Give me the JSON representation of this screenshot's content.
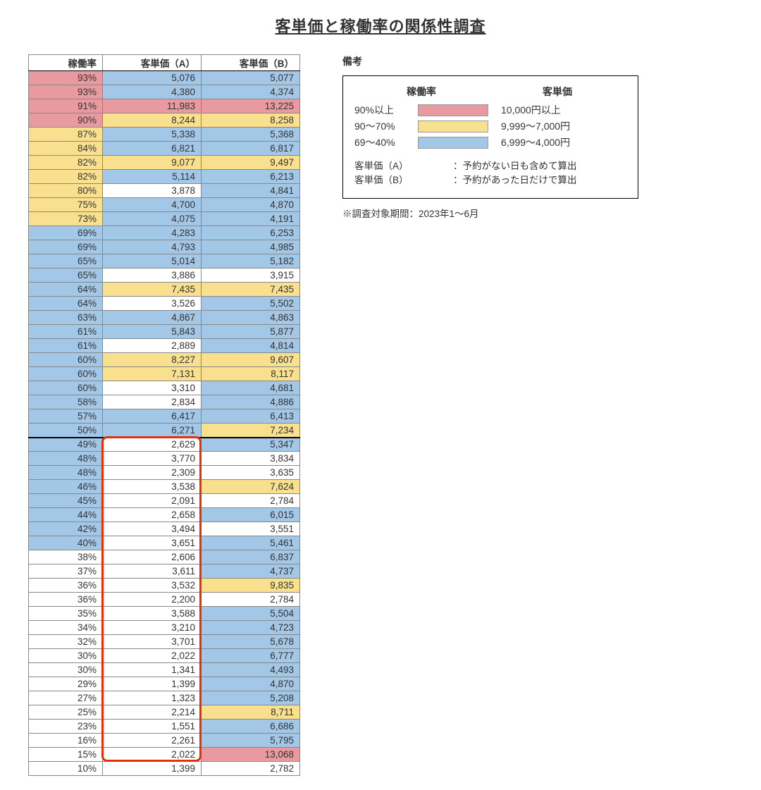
{
  "title": "客単価と稼働率の関係性調査",
  "columns": {
    "rate": "稼働率",
    "a": "客単価（A）",
    "b": "客単価（B）"
  },
  "legend": {
    "title": "備考",
    "head_rate": "稼働率",
    "head_price": "客単価",
    "rows": [
      {
        "rate": "90%以上",
        "price": "10,000円以上",
        "color": "c-pink"
      },
      {
        "rate": "90～70%",
        "price": "9,999～7,000円",
        "color": "c-yellow"
      },
      {
        "rate": "69～40%",
        "price": "6,999～4,000円",
        "color": "c-blue"
      }
    ],
    "notes": [
      {
        "k": "客単価（A）",
        "v": "：予約がない日も含めて算出"
      },
      {
        "k": "客単価（B）",
        "v": "：予約があった日だけで算出"
      }
    ],
    "period": "※調査対象期間：2023年1～6月"
  },
  "highlight": {
    "col": "a",
    "from_row": 26,
    "to_row": 48
  },
  "rows": [
    {
      "rate": "93%",
      "rc": "c-pink",
      "a": "5,076",
      "ac": "c-blue",
      "b": "5,077",
      "bc": "c-blue"
    },
    {
      "rate": "93%",
      "rc": "c-pink",
      "a": "4,380",
      "ac": "c-blue",
      "b": "4,374",
      "bc": "c-blue"
    },
    {
      "rate": "91%",
      "rc": "c-pink",
      "a": "11,983",
      "ac": "c-pink",
      "b": "13,225",
      "bc": "c-pink"
    },
    {
      "rate": "90%",
      "rc": "c-pink",
      "a": "8,244",
      "ac": "c-yellow",
      "b": "8,258",
      "bc": "c-yellow"
    },
    {
      "rate": "87%",
      "rc": "c-yellow",
      "a": "5,338",
      "ac": "c-blue",
      "b": "5,368",
      "bc": "c-blue"
    },
    {
      "rate": "84%",
      "rc": "c-yellow",
      "a": "6,821",
      "ac": "c-blue",
      "b": "6,817",
      "bc": "c-blue"
    },
    {
      "rate": "82%",
      "rc": "c-yellow",
      "a": "9,077",
      "ac": "c-yellow",
      "b": "9,497",
      "bc": "c-yellow"
    },
    {
      "rate": "82%",
      "rc": "c-yellow",
      "a": "5,114",
      "ac": "c-blue",
      "b": "6,213",
      "bc": "c-blue"
    },
    {
      "rate": "80%",
      "rc": "c-yellow",
      "a": "3,878",
      "ac": "c-white",
      "b": "4,841",
      "bc": "c-blue"
    },
    {
      "rate": "75%",
      "rc": "c-yellow",
      "a": "4,700",
      "ac": "c-blue",
      "b": "4,870",
      "bc": "c-blue"
    },
    {
      "rate": "73%",
      "rc": "c-yellow",
      "a": "4,075",
      "ac": "c-blue",
      "b": "4,191",
      "bc": "c-blue"
    },
    {
      "rate": "69%",
      "rc": "c-blue",
      "a": "4,283",
      "ac": "c-blue",
      "b": "6,253",
      "bc": "c-blue"
    },
    {
      "rate": "69%",
      "rc": "c-blue",
      "a": "4,793",
      "ac": "c-blue",
      "b": "4,985",
      "bc": "c-blue"
    },
    {
      "rate": "65%",
      "rc": "c-blue",
      "a": "5,014",
      "ac": "c-blue",
      "b": "5,182",
      "bc": "c-blue"
    },
    {
      "rate": "65%",
      "rc": "c-blue",
      "a": "3,886",
      "ac": "c-white",
      "b": "3,915",
      "bc": "c-white"
    },
    {
      "rate": "64%",
      "rc": "c-blue",
      "a": "7,435",
      "ac": "c-yellow",
      "b": "7,435",
      "bc": "c-yellow"
    },
    {
      "rate": "64%",
      "rc": "c-blue",
      "a": "3,526",
      "ac": "c-white",
      "b": "5,502",
      "bc": "c-blue"
    },
    {
      "rate": "63%",
      "rc": "c-blue",
      "a": "4,867",
      "ac": "c-blue",
      "b": "4,863",
      "bc": "c-blue"
    },
    {
      "rate": "61%",
      "rc": "c-blue",
      "a": "5,843",
      "ac": "c-blue",
      "b": "5,877",
      "bc": "c-blue"
    },
    {
      "rate": "61%",
      "rc": "c-blue",
      "a": "2,889",
      "ac": "c-white",
      "b": "4,814",
      "bc": "c-blue"
    },
    {
      "rate": "60%",
      "rc": "c-blue",
      "a": "8,227",
      "ac": "c-yellow",
      "b": "9,607",
      "bc": "c-yellow"
    },
    {
      "rate": "60%",
      "rc": "c-blue",
      "a": "7,131",
      "ac": "c-yellow",
      "b": "8,117",
      "bc": "c-yellow"
    },
    {
      "rate": "60%",
      "rc": "c-blue",
      "a": "3,310",
      "ac": "c-white",
      "b": "4,681",
      "bc": "c-blue"
    },
    {
      "rate": "58%",
      "rc": "c-blue",
      "a": "2,834",
      "ac": "c-white",
      "b": "4,886",
      "bc": "c-blue"
    },
    {
      "rate": "57%",
      "rc": "c-blue",
      "a": "6,417",
      "ac": "c-blue",
      "b": "6,413",
      "bc": "c-blue"
    },
    {
      "rate": "50%",
      "rc": "c-blue",
      "a": "6,271",
      "ac": "c-blue",
      "b": "7,234",
      "bc": "c-yellow",
      "sep": true
    },
    {
      "rate": "49%",
      "rc": "c-blue",
      "a": "2,629",
      "ac": "c-white",
      "b": "5,347",
      "bc": "c-blue"
    },
    {
      "rate": "48%",
      "rc": "c-blue",
      "a": "3,770",
      "ac": "c-white",
      "b": "3,834",
      "bc": "c-white"
    },
    {
      "rate": "48%",
      "rc": "c-blue",
      "a": "2,309",
      "ac": "c-white",
      "b": "3,635",
      "bc": "c-white"
    },
    {
      "rate": "46%",
      "rc": "c-blue",
      "a": "3,538",
      "ac": "c-white",
      "b": "7,624",
      "bc": "c-yellow"
    },
    {
      "rate": "45%",
      "rc": "c-blue",
      "a": "2,091",
      "ac": "c-white",
      "b": "2,784",
      "bc": "c-white"
    },
    {
      "rate": "44%",
      "rc": "c-blue",
      "a": "2,658",
      "ac": "c-white",
      "b": "6,015",
      "bc": "c-blue"
    },
    {
      "rate": "42%",
      "rc": "c-blue",
      "a": "3,494",
      "ac": "c-white",
      "b": "3,551",
      "bc": "c-white"
    },
    {
      "rate": "40%",
      "rc": "c-blue",
      "a": "3,651",
      "ac": "c-white",
      "b": "5,461",
      "bc": "c-blue"
    },
    {
      "rate": "38%",
      "rc": "c-white",
      "a": "2,606",
      "ac": "c-white",
      "b": "6,837",
      "bc": "c-blue"
    },
    {
      "rate": "37%",
      "rc": "c-white",
      "a": "3,611",
      "ac": "c-white",
      "b": "4,737",
      "bc": "c-blue"
    },
    {
      "rate": "36%",
      "rc": "c-white",
      "a": "3,532",
      "ac": "c-white",
      "b": "9,835",
      "bc": "c-yellow"
    },
    {
      "rate": "36%",
      "rc": "c-white",
      "a": "2,200",
      "ac": "c-white",
      "b": "2,784",
      "bc": "c-white"
    },
    {
      "rate": "35%",
      "rc": "c-white",
      "a": "3,588",
      "ac": "c-white",
      "b": "5,504",
      "bc": "c-blue"
    },
    {
      "rate": "34%",
      "rc": "c-white",
      "a": "3,210",
      "ac": "c-white",
      "b": "4,723",
      "bc": "c-blue"
    },
    {
      "rate": "32%",
      "rc": "c-white",
      "a": "3,701",
      "ac": "c-white",
      "b": "5,678",
      "bc": "c-blue"
    },
    {
      "rate": "30%",
      "rc": "c-white",
      "a": "2,022",
      "ac": "c-white",
      "b": "6,777",
      "bc": "c-blue"
    },
    {
      "rate": "30%",
      "rc": "c-white",
      "a": "1,341",
      "ac": "c-white",
      "b": "4,493",
      "bc": "c-blue"
    },
    {
      "rate": "29%",
      "rc": "c-white",
      "a": "1,399",
      "ac": "c-white",
      "b": "4,870",
      "bc": "c-blue"
    },
    {
      "rate": "27%",
      "rc": "c-white",
      "a": "1,323",
      "ac": "c-white",
      "b": "5,208",
      "bc": "c-blue"
    },
    {
      "rate": "25%",
      "rc": "c-white",
      "a": "2,214",
      "ac": "c-white",
      "b": "8,711",
      "bc": "c-yellow"
    },
    {
      "rate": "23%",
      "rc": "c-white",
      "a": "1,551",
      "ac": "c-white",
      "b": "6,686",
      "bc": "c-blue"
    },
    {
      "rate": "16%",
      "rc": "c-white",
      "a": "2,261",
      "ac": "c-white",
      "b": "5,795",
      "bc": "c-blue"
    },
    {
      "rate": "15%",
      "rc": "c-white",
      "a": "2,022",
      "ac": "c-white",
      "b": "13,068",
      "bc": "c-pink"
    },
    {
      "rate": "10%",
      "rc": "c-white",
      "a": "1,399",
      "ac": "c-white",
      "b": "2,782",
      "bc": "c-white"
    }
  ]
}
